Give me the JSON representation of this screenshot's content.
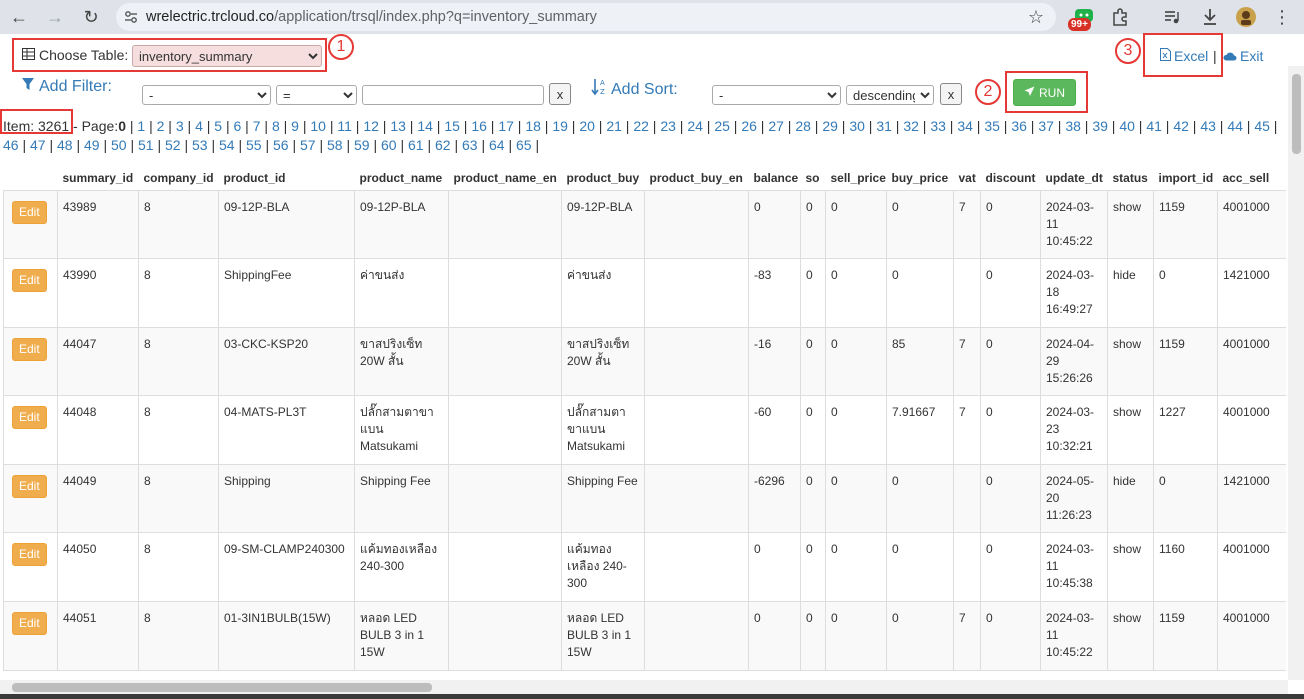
{
  "browser": {
    "url_host": "wrelectric.trcloud.co",
    "url_path": "/application/trsql/index.php?q=inventory_summary",
    "badge": "99+"
  },
  "toolbar": {
    "choose_table_label": "Choose Table:",
    "table_value": "inventory_summary",
    "excel_label": "Excel",
    "separator": "|",
    "exit_label": "Exit",
    "callouts": [
      "1",
      "2",
      "3"
    ]
  },
  "filter": {
    "label": "Add Filter:",
    "field_value": "-",
    "operator_value": "=",
    "text_value": "",
    "clear_label": "x"
  },
  "sort": {
    "label": "Add Sort:",
    "field_value": "-",
    "direction_value": "descending",
    "clear_label": "x",
    "run_label": "RUN"
  },
  "pager": {
    "item_count": "Item: 3261",
    "page_prefix": " - Page:",
    "current_page": "0",
    "line1_pages": [
      "1",
      "2",
      "3",
      "4",
      "5",
      "6",
      "7",
      "8",
      "9",
      "10",
      "11",
      "12",
      "13",
      "14",
      "15",
      "16",
      "17",
      "18",
      "19",
      "20",
      "21",
      "22",
      "23",
      "24",
      "25",
      "26",
      "27",
      "28",
      "29",
      "30",
      "31",
      "32",
      "33",
      "34",
      "35",
      "36",
      "37",
      "38",
      "39",
      "40",
      "41",
      "42",
      "43",
      "44",
      "45"
    ],
    "line2_pages": [
      "46",
      "47",
      "48",
      "49",
      "50",
      "51",
      "52",
      "53",
      "54",
      "55",
      "56",
      "57",
      "58",
      "59",
      "60",
      "61",
      "62",
      "63",
      "64",
      "65"
    ]
  },
  "table": {
    "edit_label": "Edit",
    "headers": [
      "",
      "summary_id",
      "company_id",
      "product_id",
      "product_name",
      "product_name_en",
      "product_buy",
      "product_buy_en",
      "balance",
      "so",
      "sell_price",
      "buy_price",
      "vat",
      "discount",
      "update_dt",
      "status",
      "import_id",
      "acc_sell"
    ],
    "rows": [
      [
        "43989",
        "8",
        "09-12P-BLA",
        "09-12P-BLA",
        "",
        "09-12P-BLA",
        "",
        "0",
        "0",
        "0",
        "0",
        "7",
        "0",
        "2024-03-11 10:45:22",
        "show",
        "1159",
        "4001000"
      ],
      [
        "43990",
        "8",
        "ShippingFee",
        "ค่าขนส่ง",
        "",
        "ค่าขนส่ง",
        "",
        "-83",
        "0",
        "0",
        "0",
        "",
        "0",
        "2024-03-18 16:49:27",
        "hide",
        "0",
        "1421000"
      ],
      [
        "44047",
        "8",
        "03-CKC-KSP20",
        "ขาสปริงเซ็ท 20W สั้น",
        "",
        "ขาสปริงเซ็ท 20W สั้น",
        "",
        "-16",
        "0",
        "0",
        "85",
        "7",
        "0",
        "2024-04-29 15:26:26",
        "show",
        "1159",
        "4001000"
      ],
      [
        "44048",
        "8",
        "04-MATS-PL3T",
        "ปลั๊กสามตาขาแบน Matsukami",
        "",
        "ปลั๊กสามตาขาแบน Matsukami",
        "",
        "-60",
        "0",
        "0",
        "7.91667",
        "7",
        "0",
        "2024-03-23 10:32:21",
        "show",
        "1227",
        "4001000"
      ],
      [
        "44049",
        "8",
        "Shipping",
        "Shipping Fee",
        "",
        "Shipping Fee",
        "",
        "-6296",
        "0",
        "0",
        "0",
        "",
        "0",
        "2024-05-20 11:26:23",
        "hide",
        "0",
        "1421000"
      ],
      [
        "44050",
        "8",
        "09-SM-CLAMP240300",
        "แค้มทองเหลือง 240-300",
        "",
        "แค้มทองเหลือง 240-300",
        "",
        "0",
        "0",
        "0",
        "0",
        "",
        "0",
        "2024-03-11 10:45:38",
        "show",
        "1160",
        "4001000"
      ],
      [
        "44051",
        "8",
        "01-3IN1BULB(15W)",
        "หลอด LED BULB 3 in 1 15W",
        "",
        "หลอด LED BULB 3 in 1 15W",
        "",
        "0",
        "0",
        "0",
        "0",
        "7",
        "0",
        "2024-03-11 10:45:22",
        "show",
        "1159",
        "4001000"
      ]
    ]
  },
  "colors": {
    "accent_red": "#e53935",
    "link_blue": "#337ab7",
    "run_green": "#5cb85c",
    "edit_orange": "#f0ad4e"
  }
}
